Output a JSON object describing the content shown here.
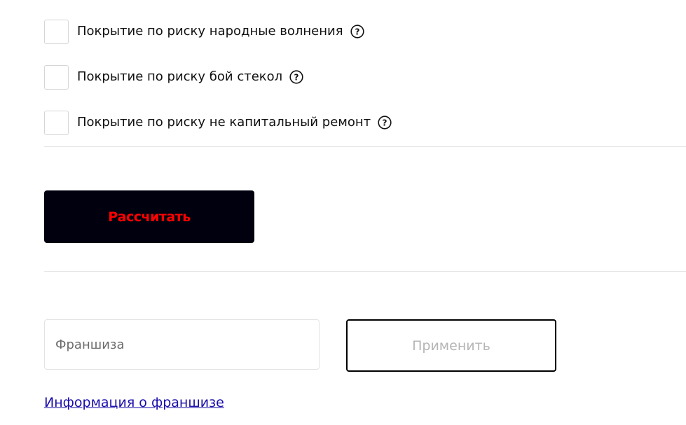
{
  "coverage_options": [
    {
      "label": "Покрытие по риску народные волнения",
      "checked": false,
      "help_icon": "question-circle"
    },
    {
      "label": "Покрытие по риску бой стекол",
      "checked": false,
      "help_icon": "question-circle"
    },
    {
      "label": "Покрытие по риску не капитальный ремонт",
      "checked": false,
      "help_icon": "question-circle"
    }
  ],
  "calculate_button": {
    "label": "Рассчитать",
    "background": "#00000f",
    "text_color": "#ff0000"
  },
  "franchise": {
    "placeholder": "Франшиза",
    "value": "",
    "apply_label": "Применить",
    "info_link": "Информация о франшизе"
  },
  "colors": {
    "link": "#1a0dab",
    "divider": "#e3e3e3",
    "disabled_text": "#b5b5b5"
  }
}
